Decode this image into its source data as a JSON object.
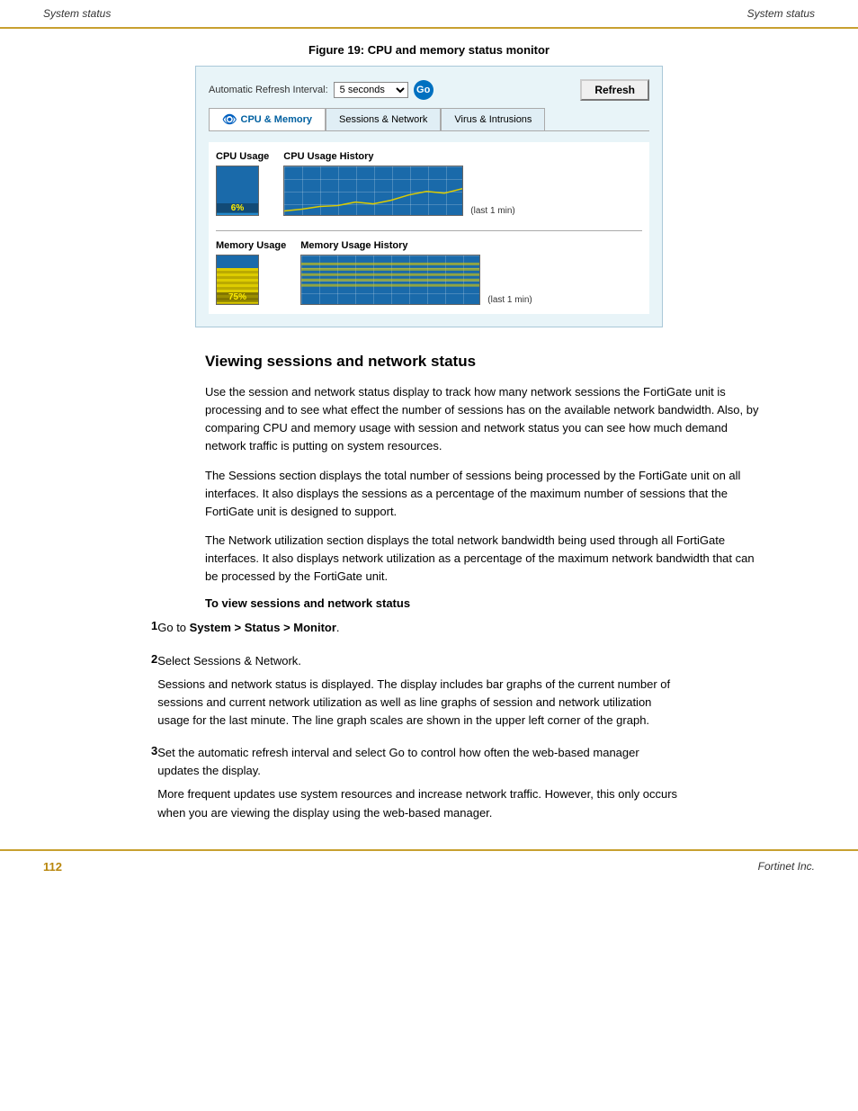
{
  "header": {
    "left": "System status",
    "right": "System status"
  },
  "figure": {
    "caption": "Figure 19: CPU and memory status monitor",
    "toolbar": {
      "label": "Automatic Refresh Interval:",
      "select_value": "5 seconds",
      "go_label": "Go",
      "refresh_label": "Refresh"
    },
    "tabs": [
      {
        "id": "cpu",
        "label": "CPU & Memory",
        "active": true,
        "icon": "👁"
      },
      {
        "id": "sessions",
        "label": "Sessions & Network",
        "active": false
      },
      {
        "id": "virus",
        "label": "Virus & Intrusions",
        "active": false
      }
    ],
    "cpu_section": {
      "usage_label": "CPU Usage",
      "usage_value": "6%",
      "history_label": "CPU Usage History",
      "time_label": "(last 1 min)"
    },
    "memory_section": {
      "usage_label": "Memory Usage",
      "usage_value": "75%",
      "history_label": "Memory Usage History",
      "time_label": "(last 1 min)"
    }
  },
  "section": {
    "heading": "Viewing sessions and network status",
    "paragraphs": [
      "Use the session and network status display to track how many network sessions the FortiGate unit is processing and to see what effect the number of sessions has on the available network bandwidth. Also, by comparing CPU and memory usage with session and network status you can see how much demand network traffic is putting on system resources.",
      "The Sessions section displays the total number of sessions being processed by the FortiGate unit on all interfaces. It also displays the sessions as a percentage of the maximum number of sessions that the FortiGate unit is designed to support.",
      "The Network utilization section displays the total network bandwidth being used through all FortiGate interfaces. It also displays network utilization as a percentage of the maximum network bandwidth that can be processed by the FortiGate unit."
    ],
    "proc_heading": "To view sessions and network status",
    "steps": [
      {
        "num": "1",
        "text": "Go to System > Status > Monitor.",
        "bold_parts": [
          "System > Status > Monitor"
        ],
        "sub": ""
      },
      {
        "num": "2",
        "text": "Select Sessions & Network.",
        "sub": "Sessions and network status is displayed. The display includes bar graphs of the current number of sessions and current network utilization as well as line graphs of session and network utilization usage for the last minute. The line graph scales are shown in the upper left corner of the graph."
      },
      {
        "num": "3",
        "text": "Set the automatic refresh interval and select Go to control how often the web-based manager updates the display.",
        "sub": "More frequent updates use system resources and increase network traffic. However, this only occurs when you are viewing the display using the web-based manager."
      }
    ]
  },
  "footer": {
    "page_number": "112",
    "company": "Fortinet Inc."
  }
}
